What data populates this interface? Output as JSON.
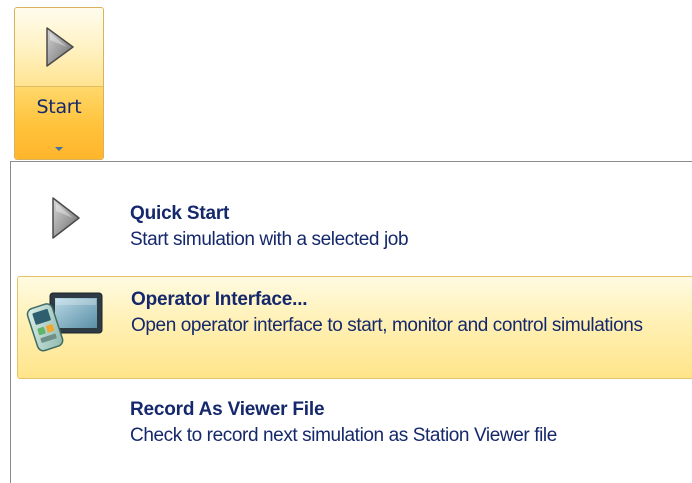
{
  "ribbon": {
    "start_label": "Start"
  },
  "menu": {
    "items": [
      {
        "title": "Quick Start",
        "description": "Start simulation with a selected job",
        "icon": "play-icon",
        "highlighted": false
      },
      {
        "title": "Operator Interface...",
        "description": "Open operator interface to start, monitor and control simulations",
        "icon": "operator-interface-icon",
        "highlighted": true
      },
      {
        "title": "Record As Viewer File",
        "description": "Check to record next simulation as Station Viewer file",
        "icon": "",
        "highlighted": false
      }
    ]
  },
  "colors": {
    "text": "#15286b",
    "highlight": "#fff0b4",
    "button_lower": "#ffc23a"
  }
}
